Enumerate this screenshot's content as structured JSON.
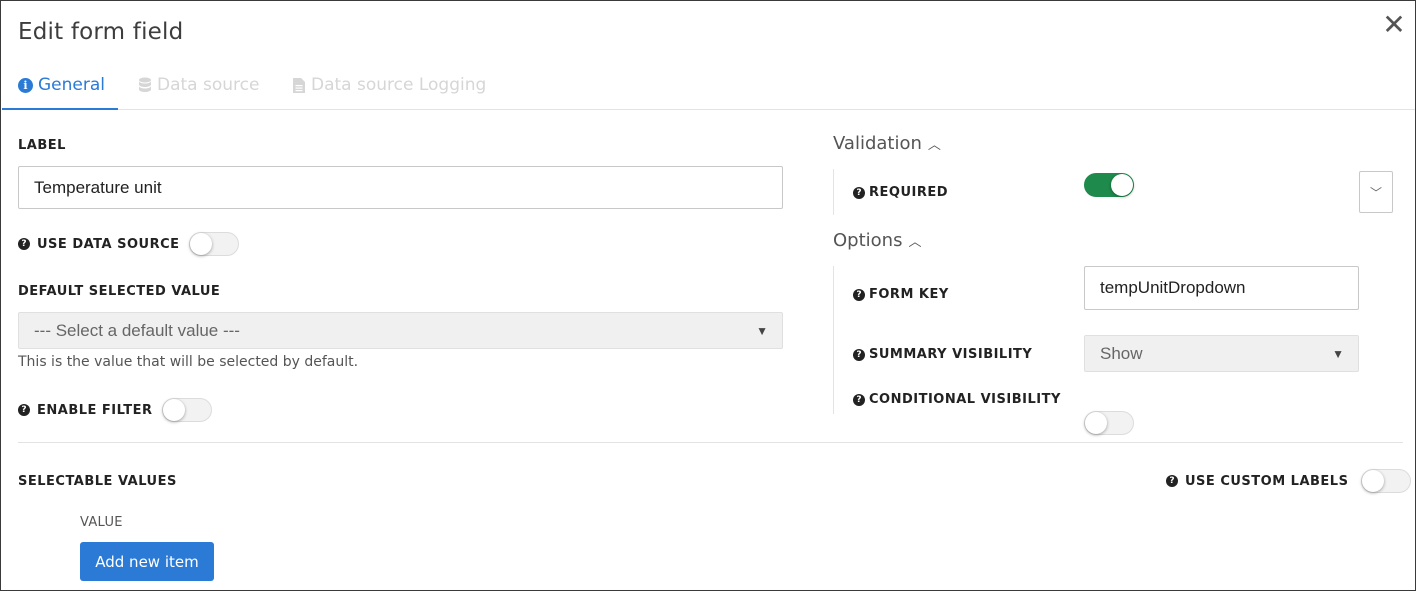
{
  "dialog": {
    "title": "Edit form field",
    "close_glyph": "✕"
  },
  "tabs": [
    {
      "label": "General",
      "icon": "info-circle-icon",
      "active": true
    },
    {
      "label": "Data source",
      "icon": "database-icon",
      "active": false
    },
    {
      "label": "Data source Logging",
      "icon": "file-icon",
      "active": false
    }
  ],
  "left": {
    "label_title": "LABEL",
    "label_value": "Temperature unit",
    "use_data_source": {
      "label": "USE DATA SOURCE",
      "on": false
    },
    "default_selected": {
      "title": "DEFAULT SELECTED VALUE",
      "placeholder": "--- Select a default value ---",
      "hint": "This is the value that will be selected by default."
    },
    "enable_filter": {
      "label": "ENABLE FILTER",
      "on": false
    }
  },
  "right": {
    "validation": {
      "title": "Validation",
      "required": {
        "label": "REQUIRED",
        "on": true
      }
    },
    "options": {
      "title": "Options",
      "form_key": {
        "label": "FORM KEY",
        "value": "tempUnitDropdown"
      },
      "summary_visibility": {
        "label": "SUMMARY VISIBILITY",
        "value": "Show"
      },
      "conditional_visibility": {
        "label": "CONDITIONAL VISIBILITY",
        "on": false
      }
    }
  },
  "selectable": {
    "title": "SELECTABLE VALUES",
    "use_custom_labels": {
      "label": "USE CUSTOM LABELS",
      "on": false
    },
    "column_header": "VALUE",
    "add_button": "Add new item"
  },
  "colors": {
    "accent": "#2a7ad6",
    "toggle_on": "#1e8a4c",
    "disabled_tab": "#d6d6d6"
  }
}
